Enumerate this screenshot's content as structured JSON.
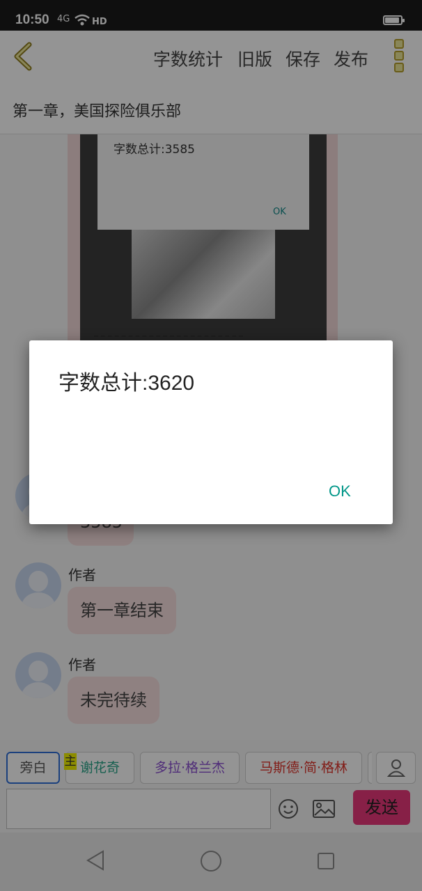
{
  "status": {
    "time": "10:50",
    "signal_text": "4G",
    "hd_text": "HD"
  },
  "toolbar": {
    "word_count": "字数统计",
    "old_version": "旧版",
    "save": "保存",
    "publish": "发布"
  },
  "chapter": {
    "title": "第一章，美国探险俱乐部"
  },
  "embedded_screenshot": {
    "count_text": "字数总计:3585",
    "ok": "OK"
  },
  "messages": [
    {
      "speaker": "",
      "text": "3585"
    },
    {
      "speaker": "作者",
      "text": "第一章结束"
    },
    {
      "speaker": "作者",
      "text": "未完待续"
    }
  ],
  "dialog": {
    "message": "字数总计:3620",
    "ok": "OK"
  },
  "roles": [
    {
      "label": "旁白",
      "color": "#555555",
      "active": true
    },
    {
      "label": "谢花奇",
      "color": "#2aa58a",
      "badge": "主"
    },
    {
      "label": "多拉·格兰杰",
      "color": "#8a4fd0"
    },
    {
      "label": "马斯德·简·格林",
      "color": "#e0342c"
    }
  ],
  "input": {
    "placeholder": "",
    "value": ""
  },
  "send": {
    "label": "发送"
  },
  "colors": {
    "accent": "#e9387a",
    "ok": "#009688",
    "bubble": "#f7dede"
  }
}
